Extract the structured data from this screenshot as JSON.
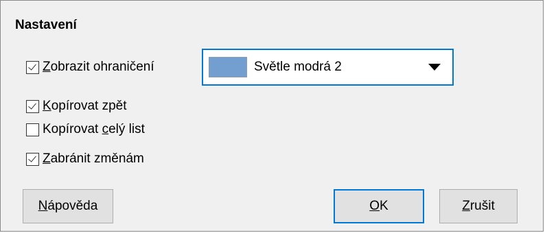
{
  "dialog": {
    "section_title": "Nastavení"
  },
  "options": {
    "show_border": {
      "label_mnemonic": "Z",
      "label_rest": "obrazit ohraničení",
      "checked": true
    },
    "copy_back": {
      "label_mnemonic": "K",
      "label_rest": "opírovat zpět",
      "checked": true
    },
    "copy_sheet": {
      "label_before": "Kopírovat ",
      "label_mnemonic": "c",
      "label_rest": "elý list",
      "checked": false
    },
    "prevent_changes": {
      "label_mnemonic": "Z",
      "label_rest": "abránit změnám",
      "checked": true
    }
  },
  "color_select": {
    "value": "Světle modrá 2",
    "swatch_color": "#729fcf",
    "icon": "dropdown-arrow-icon"
  },
  "buttons": {
    "help": {
      "mnemonic": "N",
      "rest": "ápověda"
    },
    "ok": {
      "mnemonic": "O",
      "rest": "K"
    },
    "cancel": {
      "mnemonic": "Z",
      "rest": "rušit"
    }
  },
  "colors": {
    "dialog_bg": "#f0f0f0",
    "focus_accent": "#0078d7",
    "button_bg": "#e1e1e1"
  }
}
